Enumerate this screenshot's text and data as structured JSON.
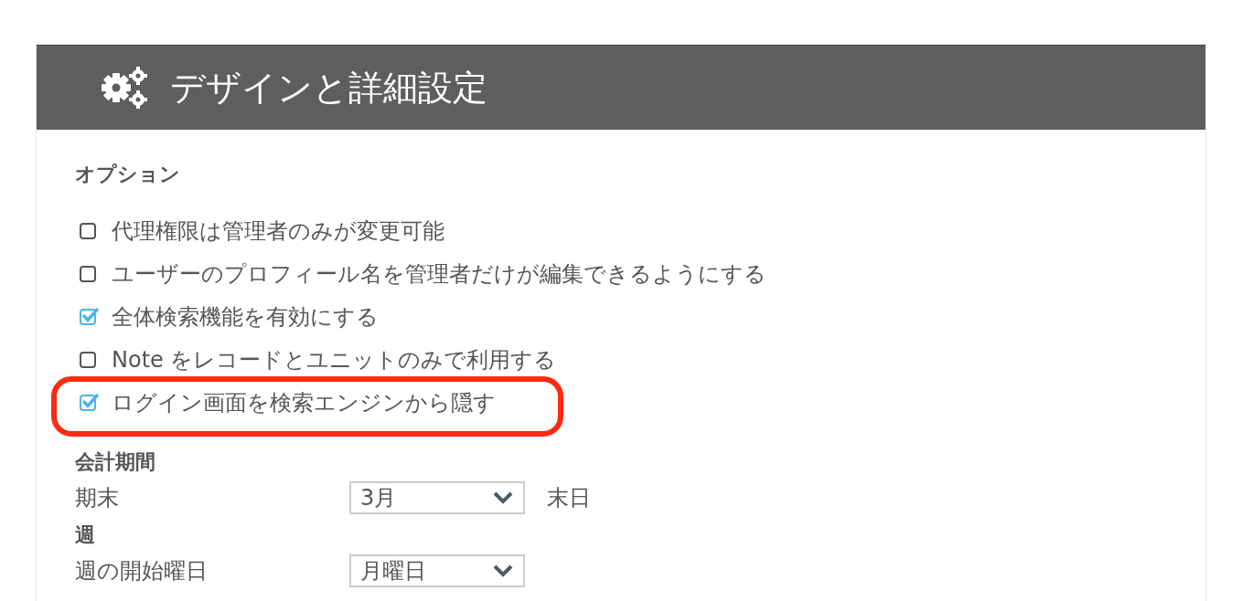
{
  "header": {
    "title": "デザインと詳細設定"
  },
  "options": {
    "heading": "オプション",
    "items": [
      {
        "label": "代理権限は管理者のみが変更可能",
        "checked": false,
        "highlighted": false
      },
      {
        "label": "ユーザーのプロフィール名を管理者だけが編集できるようにする",
        "checked": false,
        "highlighted": false
      },
      {
        "label": "全体検索機能を有効にする",
        "checked": true,
        "highlighted": false
      },
      {
        "label": "Note をレコードとユニットのみで利用する",
        "checked": false,
        "highlighted": false
      },
      {
        "label": "ログイン画面を検索エンジンから隠す",
        "checked": true,
        "highlighted": true
      }
    ]
  },
  "sections": [
    {
      "heading": "会計期間",
      "rows": [
        {
          "label": "期末",
          "value": "3月",
          "suffix": "末日"
        }
      ]
    },
    {
      "heading": "週",
      "rows": [
        {
          "label": "週の開始曜日",
          "value": "月曜日"
        }
      ]
    }
  ]
}
